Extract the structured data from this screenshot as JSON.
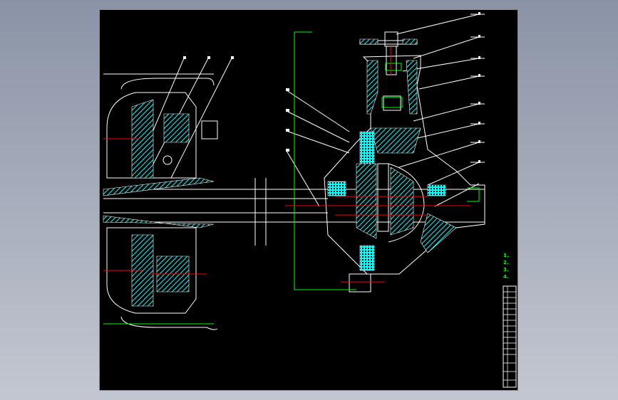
{
  "drawing": {
    "colors": {
      "background": "#000000",
      "lines": "#ffffff",
      "hatch": "#00ffff",
      "dimension": "#00ff00",
      "centerline": "#ff0000",
      "frame_backdrop": "#9aa1b1"
    },
    "legend": [
      "1.",
      "2.",
      "3.",
      "4."
    ]
  }
}
